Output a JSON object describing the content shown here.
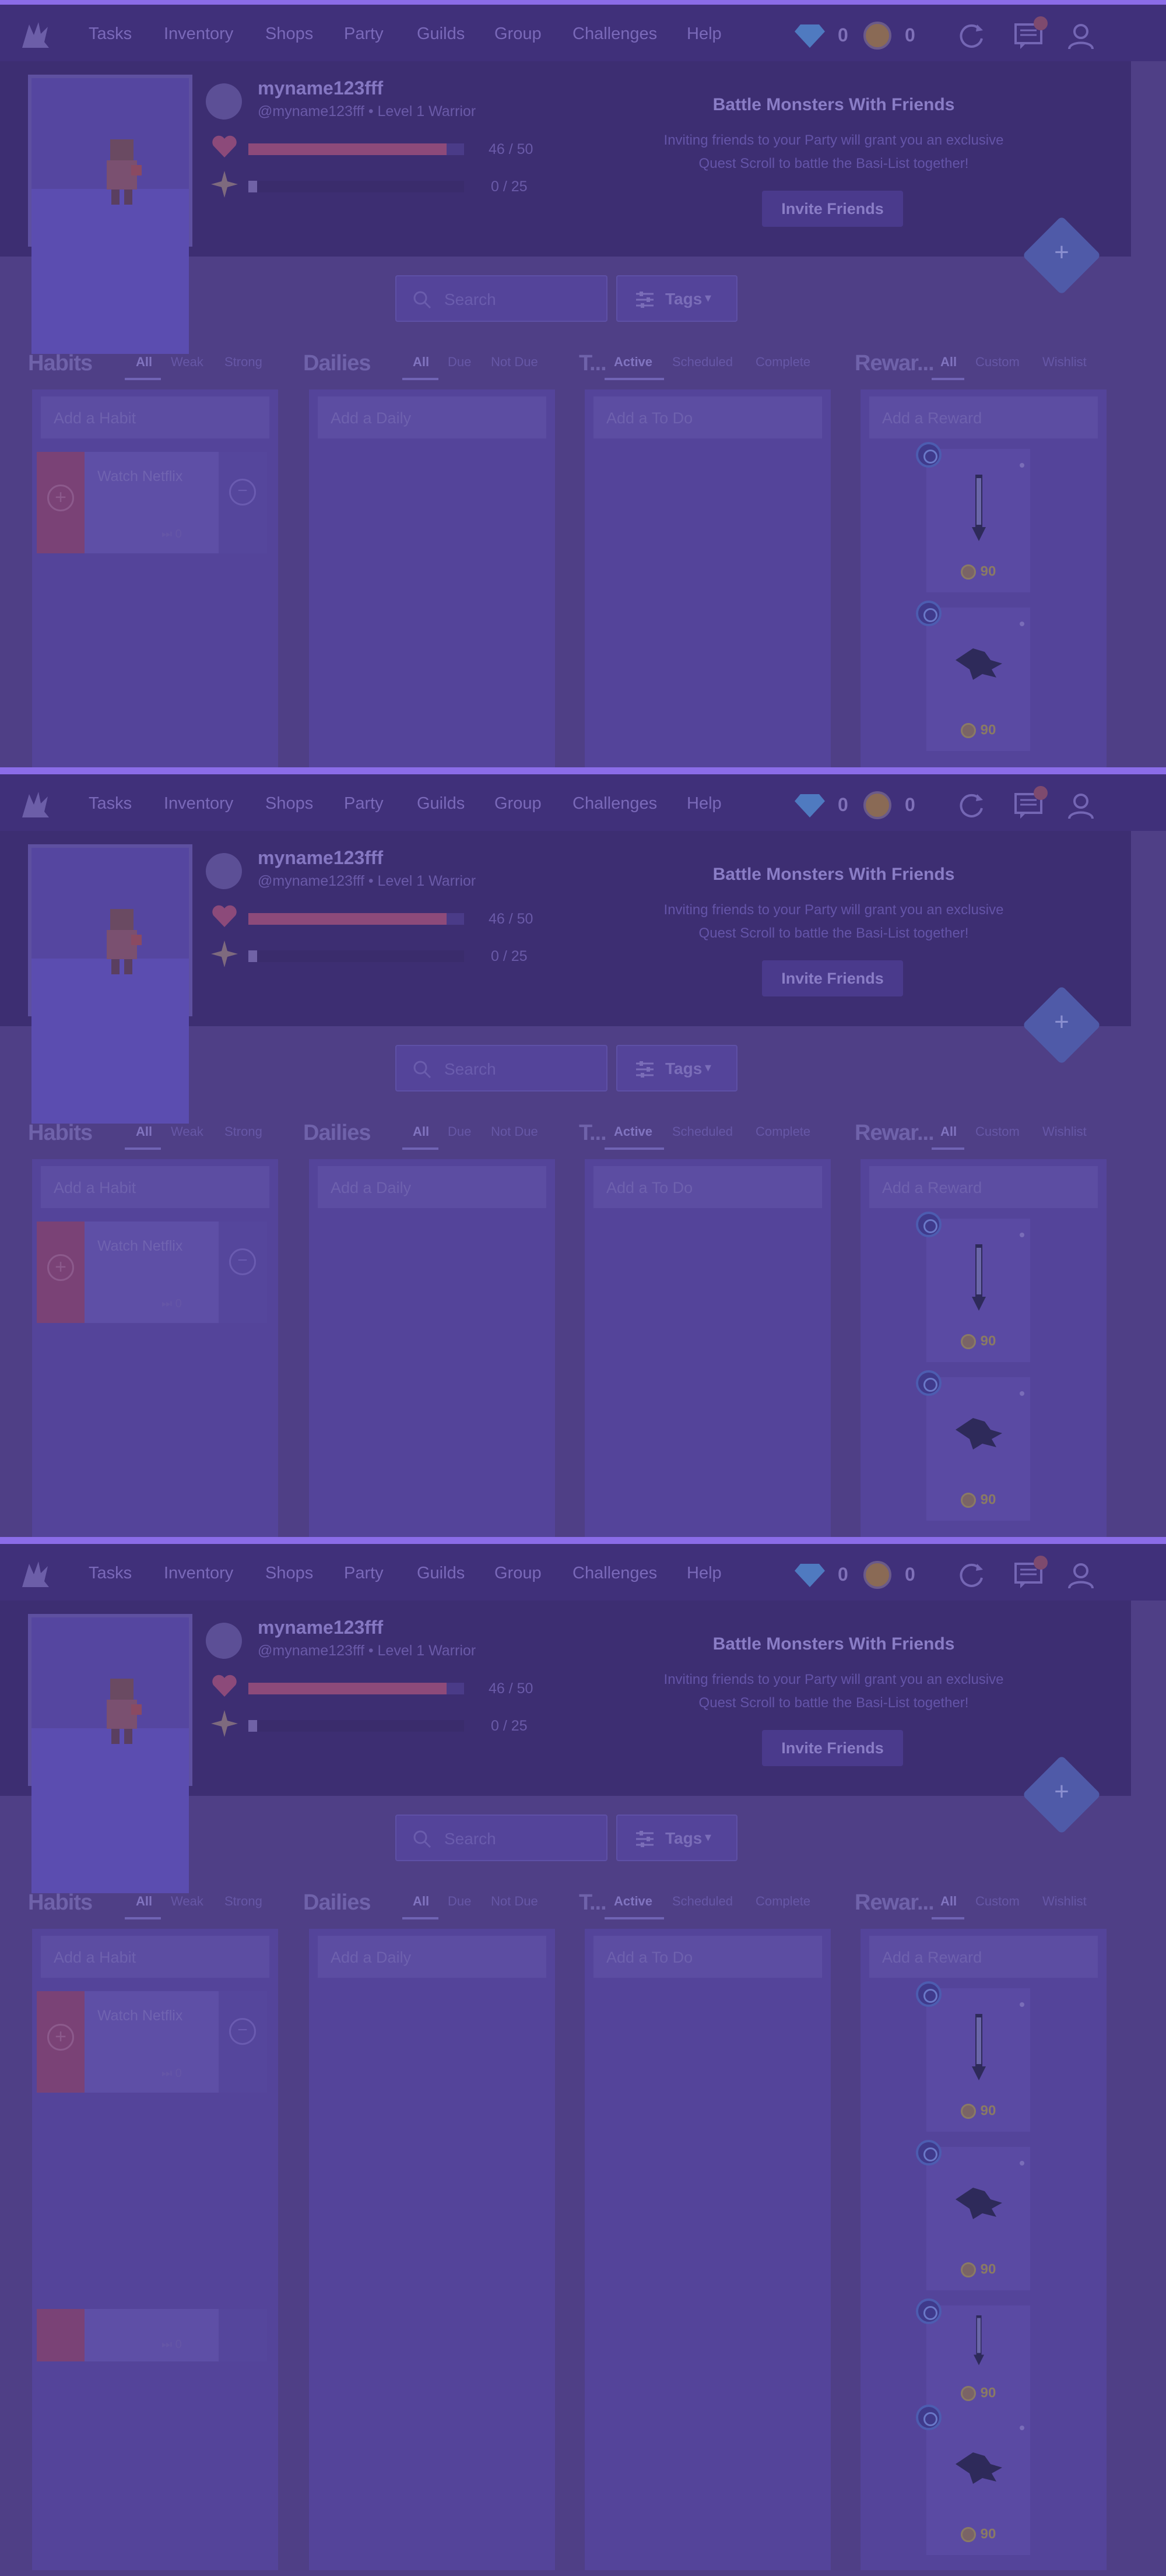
{
  "nav": {
    "items": [
      "Tasks",
      "Inventory",
      "Shops",
      "Party",
      "Guilds",
      "Group",
      "Challenges",
      "Help"
    ],
    "gems": "0",
    "gold": "0",
    "icons": [
      "logo-icon",
      "gem-icon",
      "gold-icon",
      "sync-icon",
      "chat-icon",
      "user-icon"
    ]
  },
  "user": {
    "username": "myname123fff",
    "handle_level": "@myname123fff • Level 1 Warrior",
    "hp_text": "46 / 50",
    "hp_fraction": 0.92,
    "xp_text": "0 / 25",
    "xp_fraction": 0.04
  },
  "promo": {
    "title": "Battle Monsters With Friends",
    "text": "Inviting friends to your Party will grant you an exclusive Quest Scroll to battle the Basi-List together!",
    "button": "Invite Friends"
  },
  "search": {
    "placeholder": "Search"
  },
  "tags": {
    "label": "Tags"
  },
  "columns": {
    "habits": {
      "title": "Habits",
      "filters": [
        "All",
        "Weak",
        "Strong"
      ],
      "add_placeholder": "Add a Habit",
      "items": [
        {
          "title": "Watch Netflix",
          "streak": "0"
        }
      ]
    },
    "dailies": {
      "title": "Dailies",
      "filters": [
        "All",
        "Due",
        "Not Due"
      ],
      "add_placeholder": "Add a Daily"
    },
    "todos": {
      "title": "T...",
      "filters": [
        "Active",
        "Scheduled",
        "Complete"
      ],
      "add_placeholder": "Add a To Do"
    },
    "rewards": {
      "title": "Rewar...",
      "filters": [
        "All",
        "Custom",
        "Wishlist"
      ],
      "add_placeholder": "Add a Reward",
      "items": [
        {
          "price": "90",
          "icon": "sword-icon"
        },
        {
          "price": "90",
          "icon": "wing-icon"
        }
      ]
    }
  }
}
